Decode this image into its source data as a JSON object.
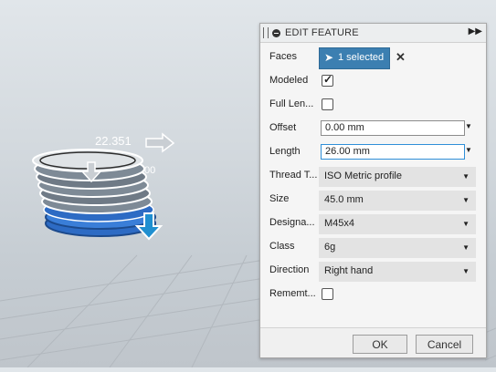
{
  "viewport": {
    "dimension_primary": "22.351",
    "dimension_secondary": ".00"
  },
  "panel": {
    "title": "EDIT FEATURE",
    "expand_icon": "double-chevron-right-icon",
    "faces": {
      "label": "Faces",
      "button": "1 selected"
    },
    "modeled": {
      "label": "Modeled",
      "checked": true
    },
    "full_length": {
      "label": "Full Len...",
      "checked": false
    },
    "offset": {
      "label": "Offset",
      "value": "0.00 mm"
    },
    "length": {
      "label": "Length",
      "value": "26.00 mm"
    },
    "thread_type": {
      "label": "Thread T...",
      "value": "ISO Metric profile"
    },
    "size": {
      "label": "Size",
      "value": "45.0 mm"
    },
    "designation": {
      "label": "Designa...",
      "value": "M45x4"
    },
    "class": {
      "label": "Class",
      "value": "6g"
    },
    "direction": {
      "label": "Direction",
      "value": "Right hand"
    },
    "remember": {
      "label": "Rememt...",
      "checked": false
    },
    "ok": "OK",
    "cancel": "Cancel"
  },
  "colors": {
    "accent": "#3c7fb1",
    "selection_blue": "#2d6bc4",
    "manipulator_arrow": "#1f8fd0"
  }
}
